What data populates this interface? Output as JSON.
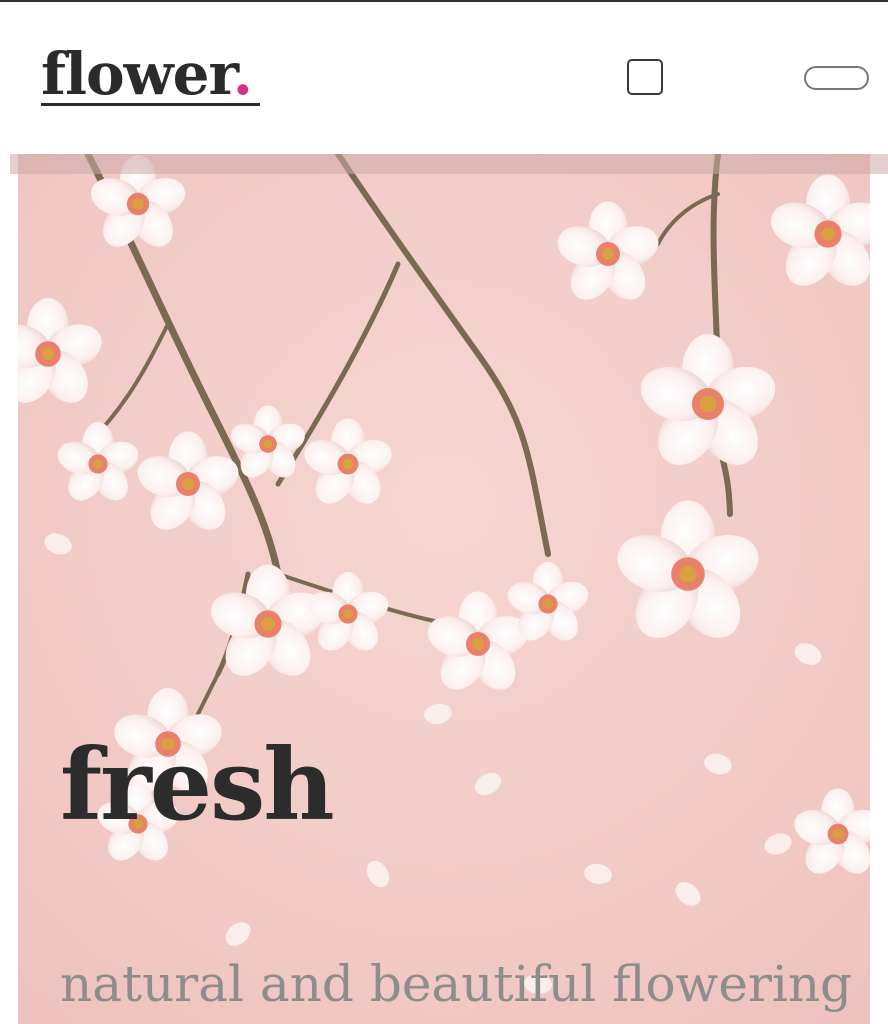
{
  "header": {
    "logo_text": "flower",
    "logo_dot": ".",
    "menu_icon": "square-icon",
    "toggle_icon": "pill-toggle-icon",
    "accent_color": "#d63384"
  },
  "hero": {
    "image": "pink-cherry-blossom-branches-photo",
    "headline": "fresh",
    "tagline": "natural and beautiful flowering"
  }
}
